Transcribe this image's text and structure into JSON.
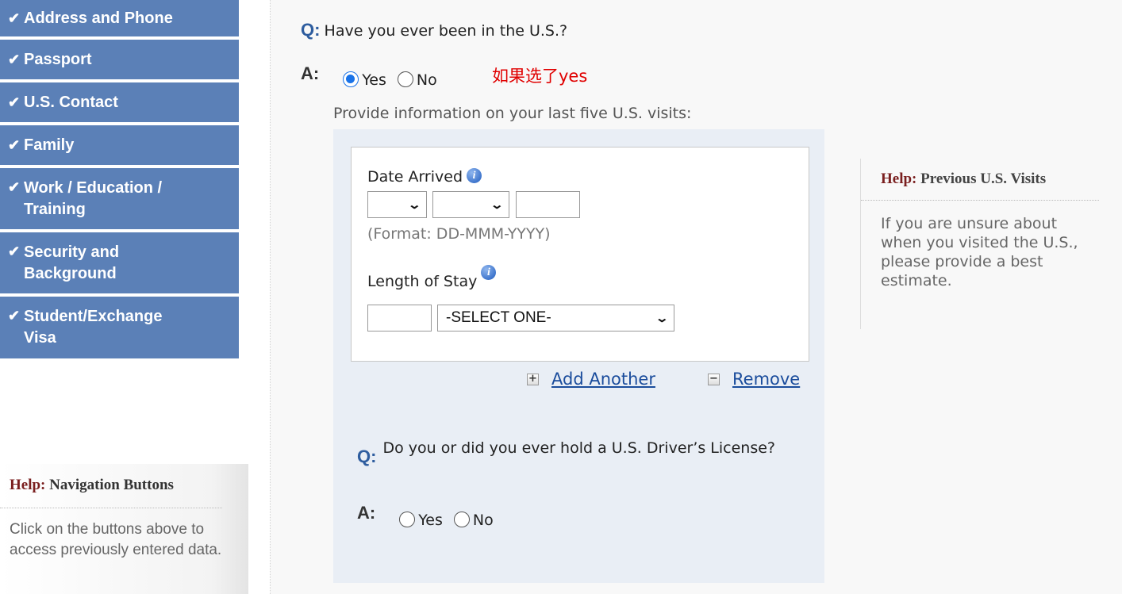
{
  "sidebar": {
    "items": [
      {
        "label": "Address and Phone"
      },
      {
        "label": "Passport"
      },
      {
        "label": "U.S. Contact"
      },
      {
        "label": "Family"
      },
      {
        "label": "Work / Education / Training",
        "line1": "Work / Education /",
        "line2": "Training"
      },
      {
        "label": "Security and Background",
        "line1": "Security and",
        "line2": "Background"
      },
      {
        "label": "Student/Exchange Visa",
        "line1": "Student/Exchange",
        "line2": "Visa"
      }
    ],
    "check_glyph": "✔",
    "help": {
      "lead": "Help:",
      "title": "Navigation Buttons",
      "text": "Click on the buttons above to access previously entered data."
    }
  },
  "main": {
    "q_prefix": "Q:",
    "a_prefix": "A:",
    "question1": "Have you ever been in the U.S.?",
    "answer1": {
      "yes": "Yes",
      "no": "No",
      "selected": "Yes"
    },
    "annotation": "如果选了yes",
    "provide_text": "Provide information on your last five U.S. visits:",
    "date_arrived_label": "Date Arrived",
    "format_hint": "(Format: DD-MMM-YYYY)",
    "length_of_stay_label": "Length of Stay",
    "length_select_value": "-SELECT ONE-",
    "add_another": "Add Another",
    "remove": "Remove",
    "question2": "Do you or did you ever hold a U.S. Driver’s License?",
    "answer2": {
      "yes": "Yes",
      "no": "No",
      "selected": null
    }
  },
  "help_right": {
    "lead": "Help:",
    "title": "Previous U.S. Visits",
    "text": "If you are unsure about when you visited the U.S., please provide a best estimate."
  },
  "colors": {
    "nav_bg": "#5b80b7",
    "q_mark": "#2e5d9f",
    "panel_bg": "#e9eef5",
    "link": "#1a4c9c",
    "annotation": "#e00000",
    "radio_selected": "#1a73e8"
  },
  "icons": {
    "check": "checkmark-icon",
    "info": "info-icon",
    "add": "plus-icon",
    "remove": "minus-icon",
    "dropdown": "chevron-down-icon"
  }
}
